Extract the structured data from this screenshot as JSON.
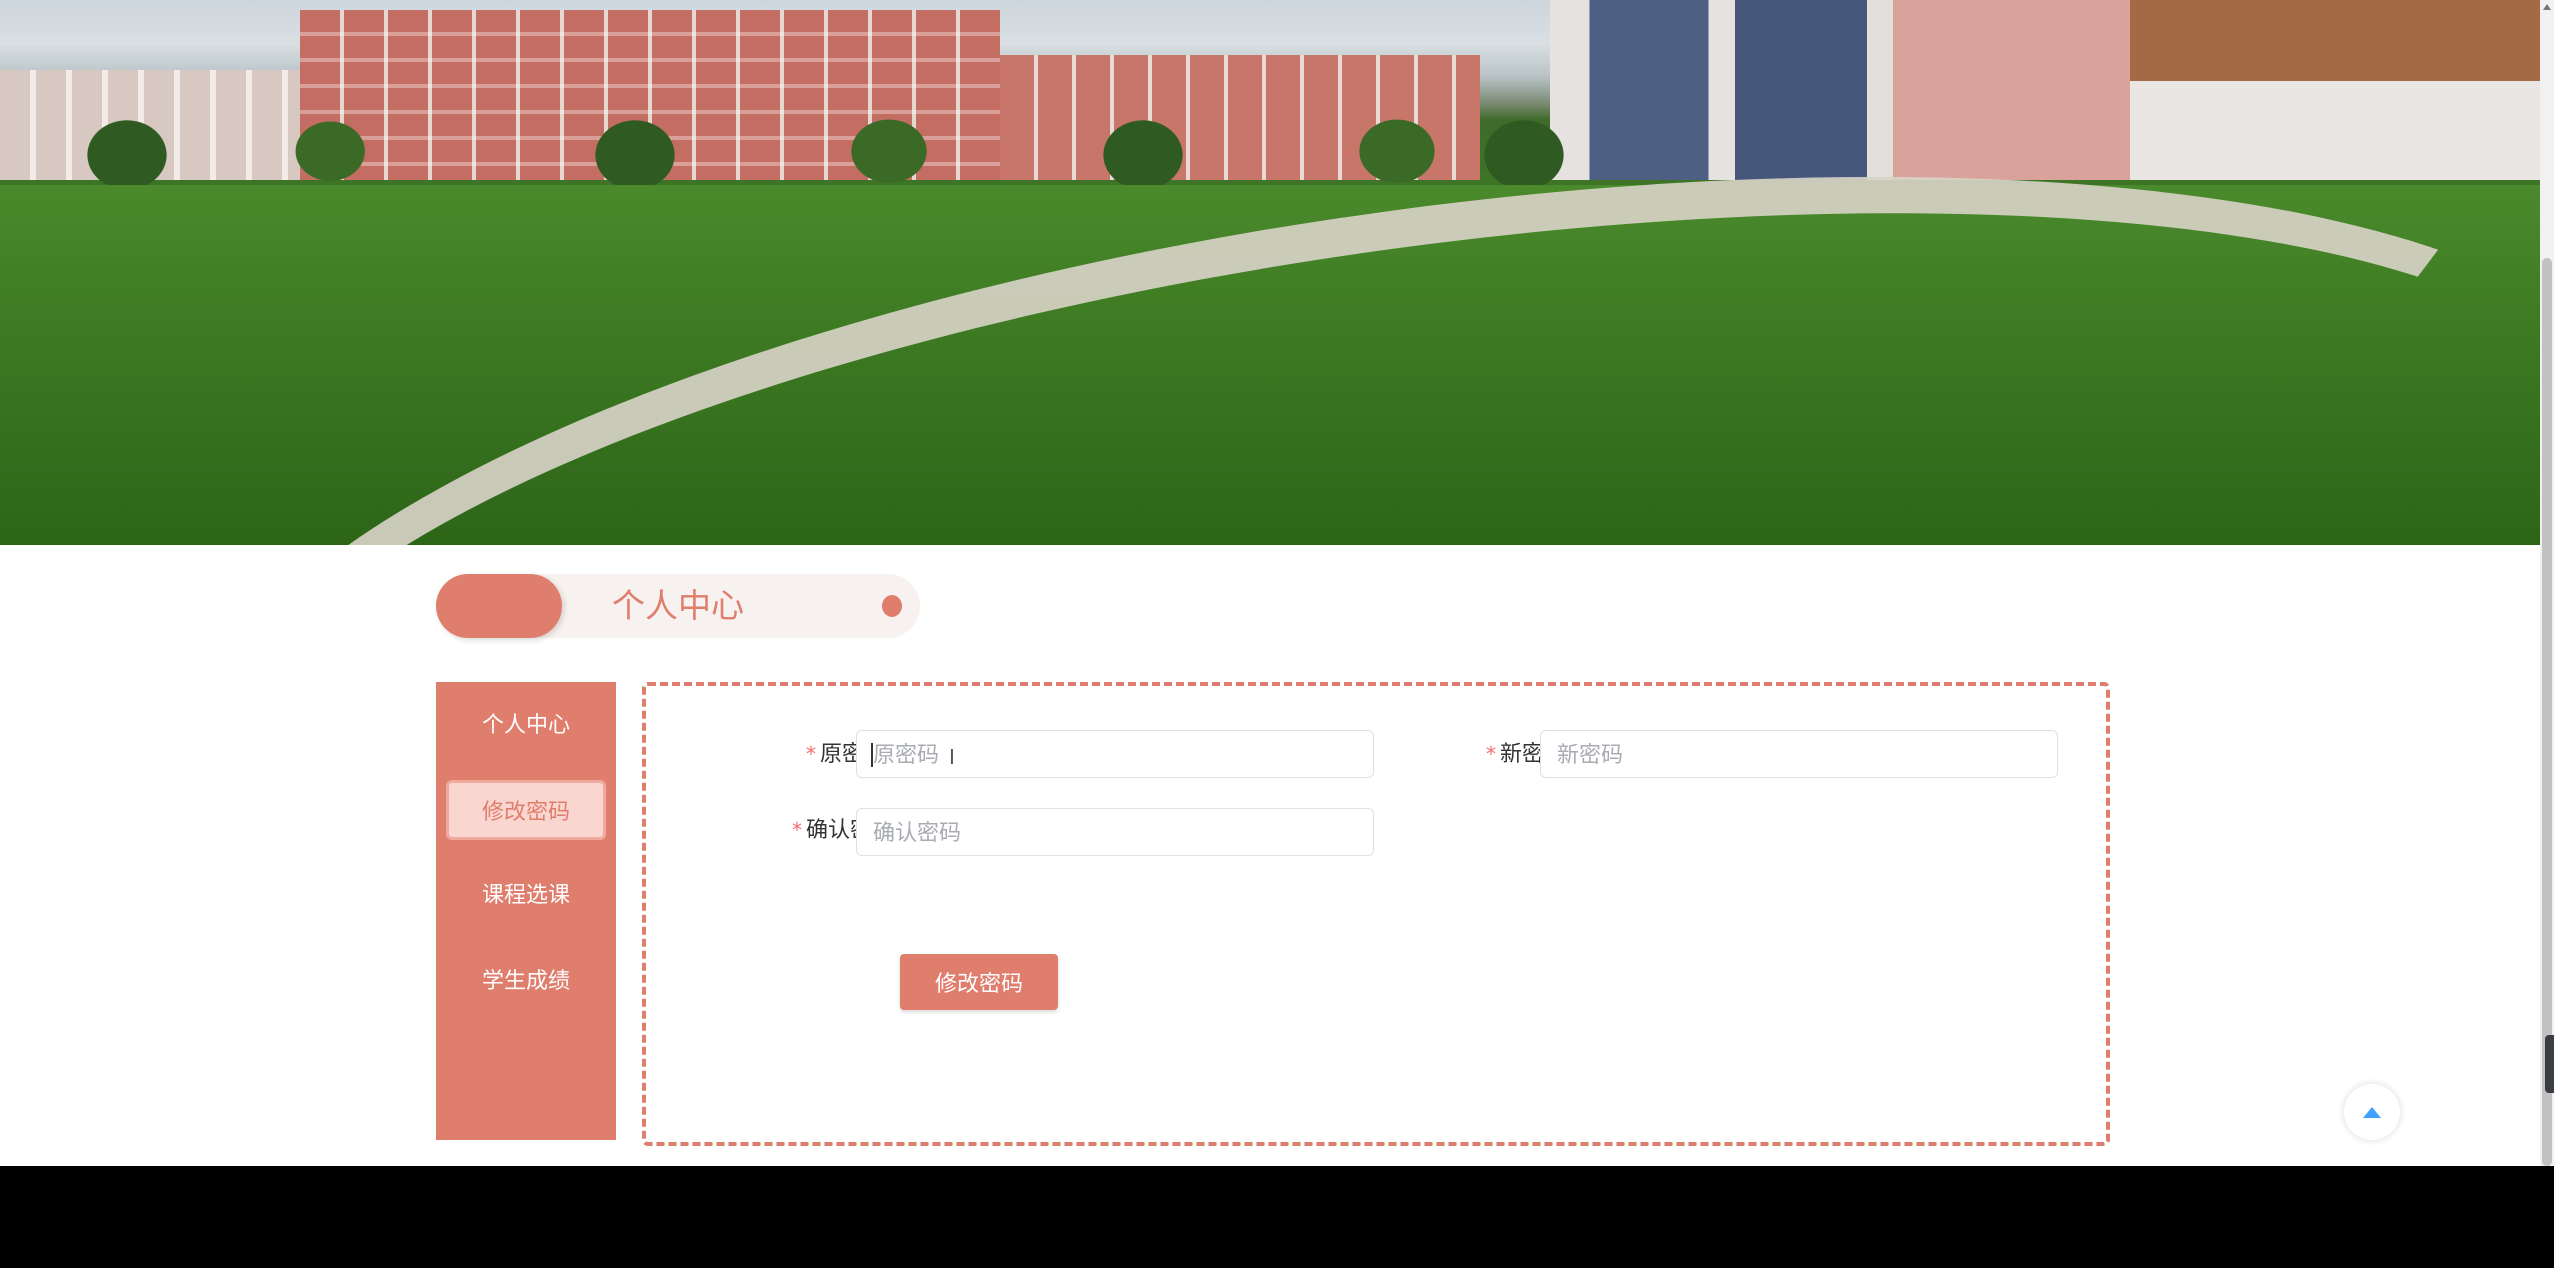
{
  "header": {
    "title": "个人中心"
  },
  "sidebar": {
    "items": [
      {
        "label": "个人中心",
        "active": false
      },
      {
        "label": "修改密码",
        "active": true
      },
      {
        "label": "课程选课",
        "active": false
      },
      {
        "label": "学生成绩",
        "active": false
      }
    ]
  },
  "form": {
    "old_password": {
      "label": "原密码",
      "placeholder": "原密码",
      "value": ""
    },
    "new_password": {
      "label": "新密码",
      "placeholder": "新密码",
      "value": ""
    },
    "confirm_password": {
      "label": "确认密码",
      "placeholder": "确认密码",
      "value": ""
    },
    "required_mark": "*",
    "submit_label": "修改密码"
  },
  "theme": {
    "accent": "#e07e6e",
    "active_bg": "#f9d6cf",
    "required": "#f56c6c",
    "backtop_icon": "#409eff"
  },
  "icons": {
    "backtop": "caret-up-icon",
    "cursor": "text-cursor-icon"
  }
}
